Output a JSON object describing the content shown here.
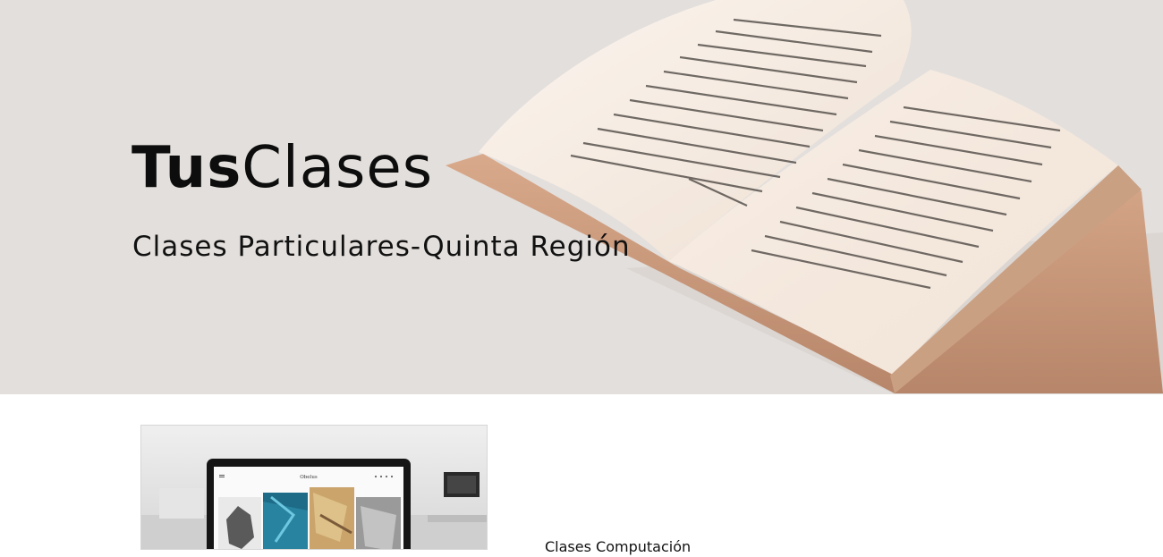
{
  "hero": {
    "brand_bold": "Tus",
    "brand_regular": "Clases",
    "tagline": "Clases Particulares-Quinta Región",
    "background_color": "#e3dfdc",
    "image_icon": "open-book-photo"
  },
  "services": {
    "items": [
      {
        "title": "Clases Computación",
        "image_icon": "laptop-gallery-photo",
        "screen_header": "Obelus"
      }
    ]
  }
}
